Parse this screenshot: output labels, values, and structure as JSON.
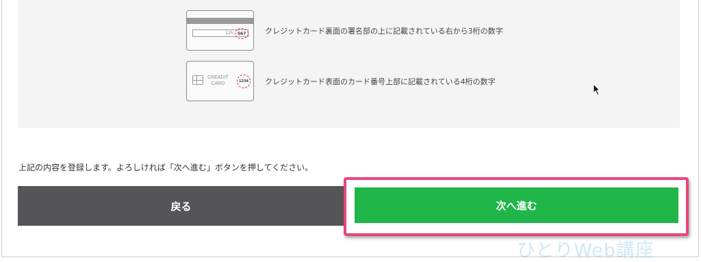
{
  "security_code_info": {
    "back_card": {
      "signature_number": "125",
      "code": "567",
      "description": "クレジットカード裏面の署名部の上に記載されている右から3桁の数字"
    },
    "front_card": {
      "brand_text": "CREADIT\nCARD",
      "code": "1234",
      "description": "クレジットカード表面のカード番号上部に記載されている4桁の数字"
    }
  },
  "confirm_message": "上記の内容を登録します。よろしければ「次へ進む」ボタンを押してください。",
  "buttons": {
    "back_label": "戻る",
    "next_label": "次へ進む"
  },
  "watermark": "ひとりWeb講座",
  "colors": {
    "back_button": "#555557",
    "next_button": "#21b64a",
    "highlight": "#e9457a",
    "code_circle": "#e2202a"
  }
}
